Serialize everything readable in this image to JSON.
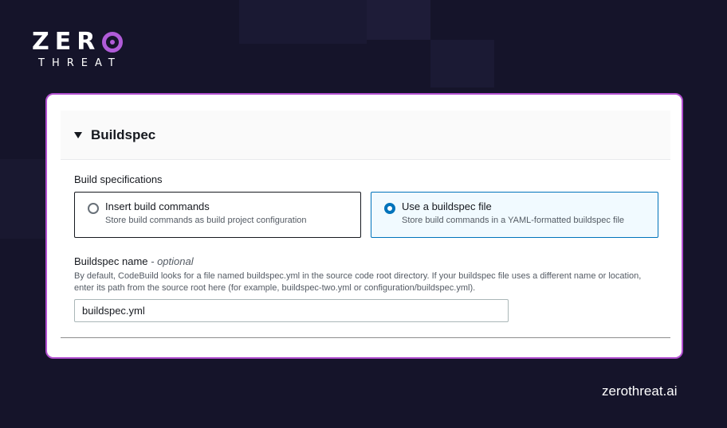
{
  "brand": {
    "logo_word": "ZER",
    "logo_sub": "THREAT",
    "website": "zerothreat.ai",
    "accent_color": "#b24fd0"
  },
  "panel": {
    "title": "Buildspec",
    "collapse_icon": "caret-down-icon",
    "build_spec_label": "Build specifications",
    "options": [
      {
        "title": "Insert build commands",
        "description": "Store build commands as build project configuration",
        "selected": false
      },
      {
        "title": "Use a buildspec file",
        "description": "Store build commands in a YAML-formatted buildspec file",
        "selected": true
      }
    ],
    "name_label": "Buildspec name",
    "name_optional": "- optional",
    "name_description": "By default, CodeBuild looks for a file named buildspec.yml in the source code root directory. If your buildspec file uses a different name or location, enter its path from the source root here (for example, buildspec-two.yml or configuration/buildspec.yml).",
    "name_value": "buildspec.yml",
    "selected_color": "#0073bb"
  }
}
